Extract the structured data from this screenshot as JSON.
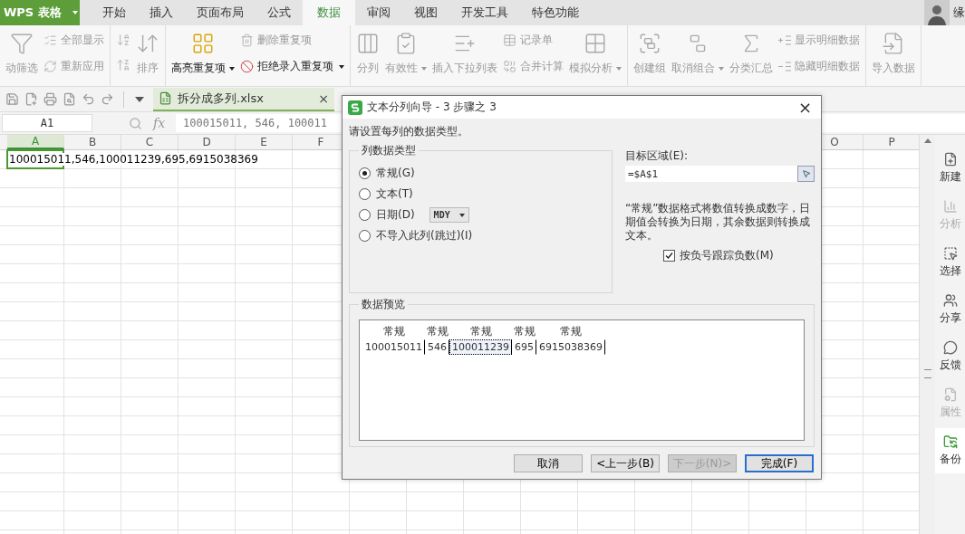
{
  "app": {
    "name": "WPS 表格"
  },
  "menu_tabs": [
    {
      "label": "开始",
      "selected": false
    },
    {
      "label": "插入",
      "selected": false
    },
    {
      "label": "页面布局",
      "selected": false
    },
    {
      "label": "公式",
      "selected": false
    },
    {
      "label": "数据",
      "selected": true
    },
    {
      "label": "审阅",
      "selected": false
    },
    {
      "label": "视图",
      "selected": false
    },
    {
      "label": "开发工具",
      "selected": false
    },
    {
      "label": "特色功能",
      "selected": false
    }
  ],
  "user": {
    "name": "缘"
  },
  "ribbon": {
    "groups": [
      {
        "items": [
          {
            "kind": "large",
            "label": "动筛选",
            "disabled": true,
            "dropdown": false
          },
          {
            "kind": "small",
            "label": "全部显示",
            "disabled": true,
            "dropdown": false
          },
          {
            "kind": "small",
            "label": "重新应用",
            "disabled": true,
            "dropdown": false
          }
        ]
      },
      {
        "items": [
          {
            "kind": "icon-stack",
            "disabled": true
          },
          {
            "kind": "large",
            "label": "排序",
            "disabled": true,
            "dropdown": false
          }
        ]
      },
      {
        "items": [
          {
            "kind": "large",
            "label": "高亮重复项",
            "disabled": false,
            "dropdown": true
          },
          {
            "kind": "small",
            "label": "删除重复项",
            "disabled": true,
            "dropdown": false
          },
          {
            "kind": "small",
            "label": "拒绝录入重复项",
            "disabled": false,
            "dropdown": true
          }
        ]
      },
      {
        "items": [
          {
            "kind": "large",
            "label": "分列",
            "disabled": true,
            "dropdown": false
          },
          {
            "kind": "large",
            "label": "有效性",
            "disabled": true,
            "dropdown": true
          },
          {
            "kind": "large",
            "label": "插入下拉列表",
            "disabled": true,
            "dropdown": false
          },
          {
            "kind": "small",
            "label": "记录单",
            "disabled": true,
            "dropdown": false
          },
          {
            "kind": "small",
            "label": "合并计算",
            "disabled": true,
            "dropdown": false
          },
          {
            "kind": "large",
            "label": "模拟分析",
            "disabled": true,
            "dropdown": true
          }
        ]
      },
      {
        "items": [
          {
            "kind": "large",
            "label": "创建组",
            "disabled": true,
            "dropdown": false
          },
          {
            "kind": "large",
            "label": "取消组合",
            "disabled": true,
            "dropdown": true
          },
          {
            "kind": "large",
            "label": "分类汇总",
            "disabled": true,
            "dropdown": false
          },
          {
            "kind": "small",
            "label": "显示明细数据",
            "disabled": true,
            "dropdown": false
          },
          {
            "kind": "small",
            "label": "隐藏明细数据",
            "disabled": true,
            "dropdown": false
          }
        ]
      },
      {
        "items": [
          {
            "kind": "large",
            "label": "导入数据",
            "disabled": true,
            "dropdown": false
          }
        ]
      }
    ]
  },
  "document_tab": {
    "title": "拆分成多列.xlsx",
    "close": "×"
  },
  "formula_bar": {
    "name_box": "A1",
    "fx": "fx",
    "formula": "100015011, 546, 100011"
  },
  "sheet": {
    "columns": [
      {
        "label": "A",
        "selected": true
      },
      {
        "label": "B",
        "selected": false
      },
      {
        "label": "C",
        "selected": false
      },
      {
        "label": "D",
        "selected": false
      },
      {
        "label": "E",
        "selected": false
      },
      {
        "label": "F",
        "selected": false
      },
      {
        "label": "O",
        "selected": false
      },
      {
        "label": "P",
        "selected": false
      }
    ],
    "rows": [
      {
        "cells": [
          {
            "text": "100015011,546,100011239,695,6915038369",
            "selected": true
          }
        ]
      }
    ]
  },
  "side_panel": [
    {
      "label": "新建",
      "disabled": false,
      "selected": false
    },
    {
      "label": "分析",
      "disabled": true,
      "selected": false
    },
    {
      "label": "选择",
      "disabled": false,
      "selected": false
    },
    {
      "label": "分享",
      "disabled": false,
      "selected": false
    },
    {
      "label": "反馈",
      "disabled": false,
      "selected": false
    },
    {
      "label": "属性",
      "disabled": true,
      "selected": false
    },
    {
      "label": "备份",
      "disabled": false,
      "selected": true
    }
  ],
  "dialog": {
    "title": "文本分列向导 - 3 步骤之 3",
    "close": "×",
    "instruction": "请设置每列的数据类型。",
    "column_type": {
      "legend": "列数据类型",
      "options": [
        {
          "label": "常规(G)",
          "selected": true
        },
        {
          "label": "文本(T)",
          "selected": false
        },
        {
          "label": "日期(D)",
          "selected": false,
          "dropdown": "MDY"
        },
        {
          "label": "不导入此列(跳过)(I)",
          "selected": false
        }
      ]
    },
    "target": {
      "label": "目标区域(E):",
      "value": "=$A$1"
    },
    "description": "“常规”数据格式将数值转换成数字，日期值会转换为日期，其余数据则转换成文本。",
    "negative_checkbox": {
      "label": "按负号跟踪负数(M)",
      "checked": true
    },
    "preview": {
      "legend": "数据预览",
      "columns": [
        {
          "header": "常规",
          "value": "100015011",
          "selected": false
        },
        {
          "header": "常规",
          "value": "546",
          "selected": false
        },
        {
          "header": "常规",
          "value": "100011239",
          "selected": true
        },
        {
          "header": "常规",
          "value": "695",
          "selected": false
        },
        {
          "header": "常规",
          "value": "6915038369",
          "selected": false
        }
      ]
    },
    "buttons": [
      {
        "label": "取消",
        "disabled": false,
        "default": false
      },
      {
        "label": "<上一步(B)",
        "disabled": false,
        "default": false
      },
      {
        "label": "下一步(N)>",
        "disabled": true,
        "default": false
      },
      {
        "label": "完成(F)",
        "disabled": false,
        "default": true
      }
    ]
  }
}
